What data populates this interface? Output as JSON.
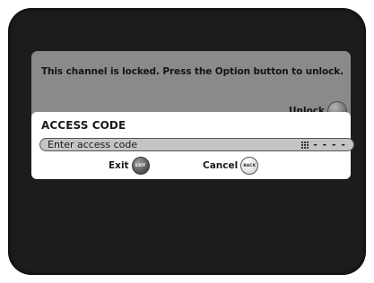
{
  "lock_banner": {
    "message": "This channel is locked. Press the Option button to unlock.",
    "unlock_label": "Unlock"
  },
  "access_panel": {
    "title": "ACCESS CODE",
    "input_placeholder": "Enter access code",
    "code_slots": "- - - -",
    "exit_label": "Exit",
    "exit_key": "EXIT",
    "cancel_label": "Cancel",
    "cancel_key": "BACK"
  },
  "colors": {
    "screen_background": "#1c1c1c",
    "banner_gray": "#8a8a8a",
    "field_gray": "#c4c4c4",
    "panel_white": "#ffffff"
  },
  "icons": {
    "unlock_key": "option-button-icon",
    "keypad": "keypad-icon",
    "exit_key": "exit-button-icon",
    "cancel_key": "back-button-icon"
  }
}
